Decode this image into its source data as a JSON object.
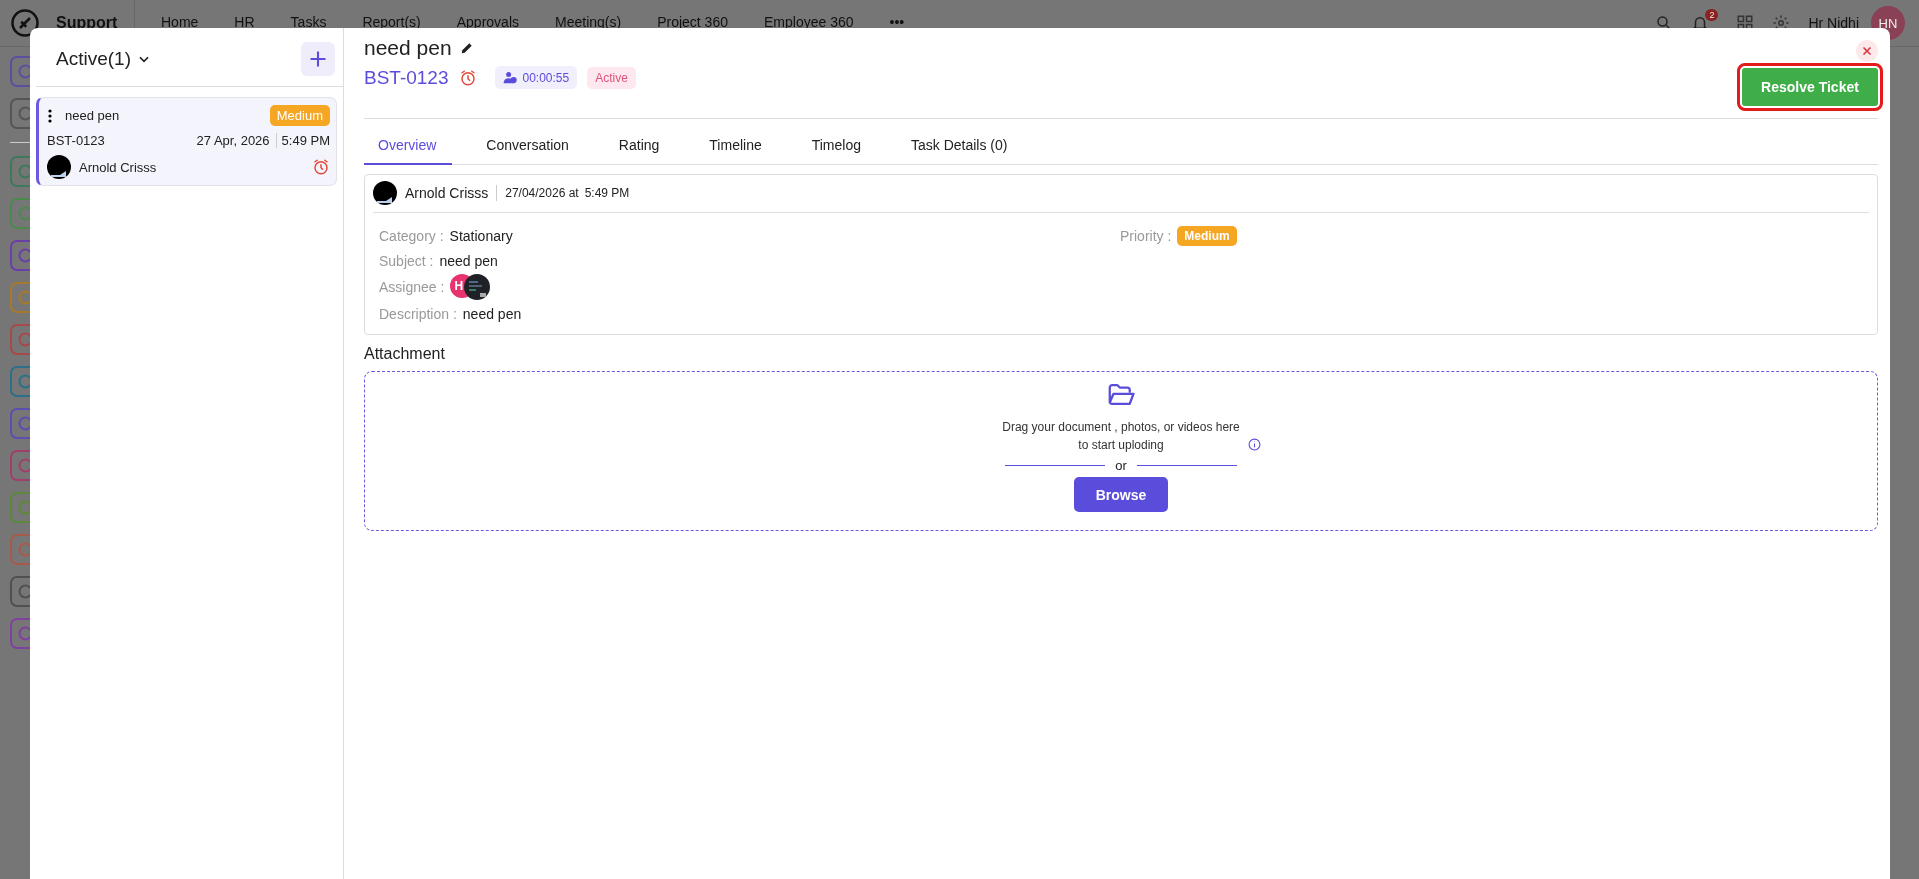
{
  "topbar": {
    "app_name": "Support",
    "menu": [
      {
        "label": "Home",
        "selected": false
      },
      {
        "label": "HR",
        "selected": false
      },
      {
        "label": "Tasks",
        "selected": false
      },
      {
        "label": "Report(s)",
        "selected": false
      },
      {
        "label": "Approvals",
        "selected": false
      },
      {
        "label": "Meeting(s)",
        "selected": false
      },
      {
        "label": "Project 360",
        "selected": false
      },
      {
        "label": "Employee 360",
        "selected": false
      }
    ],
    "more": "•••",
    "notifications": "2",
    "user_name": "Hr Nidhi",
    "user_initials": "HN"
  },
  "sidebar": {
    "icons": [
      {
        "color": "#5a4fa0"
      },
      {
        "color": "#555555"
      },
      {
        "color": "#3e7a5a"
      },
      {
        "color": "#4a8a4c"
      },
      {
        "color": "#6a3fa8"
      },
      {
        "color": "#a8782a"
      },
      {
        "color": "#a84848"
      },
      {
        "color": "#2a7088"
      },
      {
        "color": "#5a4fb0"
      },
      {
        "color": "#a0406a"
      },
      {
        "color": "#5a8a38"
      },
      {
        "color": "#a85a4a"
      },
      {
        "color": "#505050"
      },
      {
        "color": "#8040a0"
      }
    ]
  },
  "ticket_list": {
    "filter": "Active(1)",
    "tickets": [
      {
        "selected": true,
        "title": "need pen",
        "priority": "Medium",
        "id": "BST-0123",
        "date": "27 Apr, 2026",
        "time": "5:49 PM",
        "requester": "Arnold Crisss"
      }
    ]
  },
  "ticket": {
    "title": "need pen",
    "id": "BST-0123",
    "timer": "00:00:55",
    "status": "Active",
    "resolve_button": {
      "label": "Resolve Ticket",
      "highlighted": true
    },
    "tabs": [
      {
        "label": "Overview",
        "selected": true
      },
      {
        "label": "Conversation",
        "selected": false
      },
      {
        "label": "Rating",
        "selected": false
      },
      {
        "label": "Timeline",
        "selected": false
      },
      {
        "label": "Timelog",
        "selected": false
      },
      {
        "label": "Task Details (0)",
        "selected": false
      }
    ],
    "author": "Arnold Crisss",
    "date": "27/04/2026 at",
    "time": "5:49 PM",
    "fields": {
      "category_label": "Category :",
      "category": "Stationary",
      "subject_label": "Subject :",
      "subject": "need pen",
      "assignee_label": "Assignee :",
      "assignee_initials": "H",
      "description_label": "Description :",
      "description": "need pen",
      "priority_label": "Priority :",
      "priority": "Medium"
    },
    "attachment": {
      "label": "Attachment",
      "hint": "Drag your document , photos, or videos here to start uploding",
      "or": "or",
      "browse": "Browse"
    }
  }
}
